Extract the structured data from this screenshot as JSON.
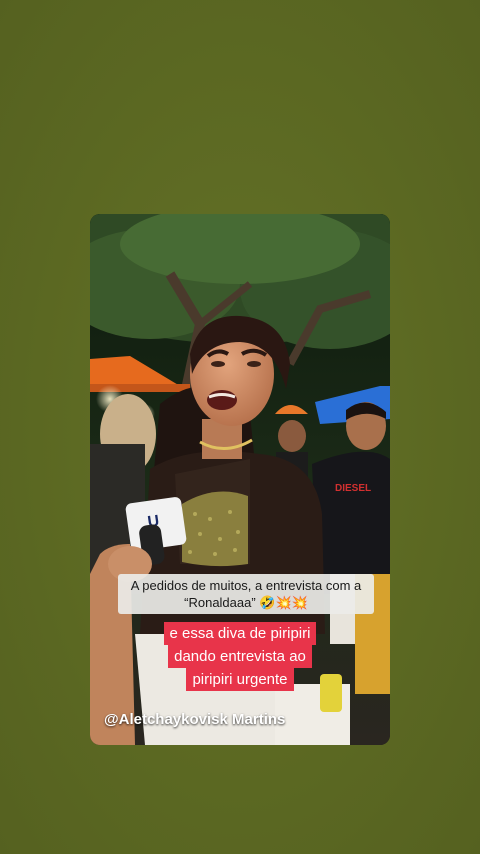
{
  "captions": {
    "top_line1": "A pedidos de muitos, a entrevista com a",
    "top_line2": "“Ronaldaaa” 🤣💥💥",
    "highlight_lines": [
      "e essa diva de piripiri",
      "dando entrevista ao",
      "piripiri urgente"
    ]
  },
  "credit": {
    "handle": "@Aletchaykovisk Martins"
  },
  "scene_labels": {
    "shirt_brand": "DIESEL",
    "mic_flag": "U"
  },
  "colors": {
    "page_background": "#5e6b24",
    "highlight_red": "#e8344a",
    "tent_orange": "#e66a1e",
    "tent_blue": "#2a6fd6"
  }
}
